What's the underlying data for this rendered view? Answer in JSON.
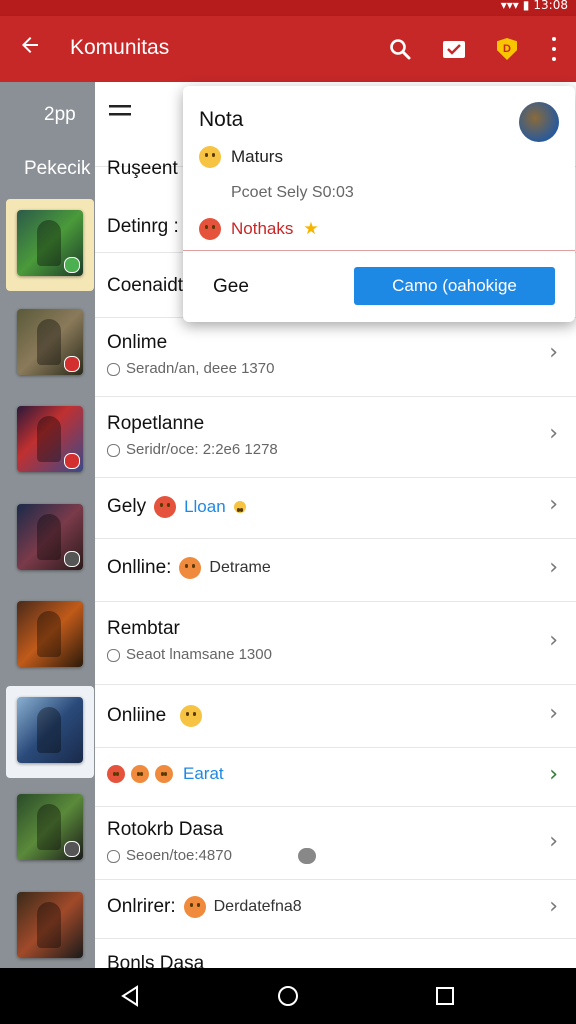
{
  "statusbar": {
    "time": "13:08"
  },
  "appbar": {
    "title": "Komunitas",
    "badge_letter": "D"
  },
  "rail": {
    "label_top": "2pp",
    "label_second": "Pekecik"
  },
  "popup": {
    "title": "Nota",
    "line1": "Maturs",
    "line2": "Pcoet Sely S0:03",
    "line3": "Nothaks",
    "close_label": "Gee",
    "cta_label": "Camo (oahokige"
  },
  "list": {
    "rows": [
      {
        "title": "Ruşeent"
      },
      {
        "title": "Detinrg :"
      },
      {
        "title": "Coenaidt"
      },
      {
        "title": "Onlime",
        "subtitle": "Seradn/an, deee 1370"
      },
      {
        "title": "Ropetlanne",
        "subtitle": "Seridr/oce: 2:2e6 1278"
      },
      {
        "title": "Gely",
        "tag": "Lloan"
      },
      {
        "title": "Onlline:",
        "tag": "Detrame"
      },
      {
        "title": "Rembtar",
        "subtitle": "Seaot lnamsane 1300"
      },
      {
        "title": "Onliine"
      },
      {
        "tag": "Earat"
      },
      {
        "title": "Rotokrb Dasa",
        "subtitle": "Seoen/toe:4870"
      },
      {
        "title": "Onlrirer:",
        "tag": "Derdatefna8"
      },
      {
        "title": "Bonls Dasa"
      }
    ]
  },
  "colors": {
    "appbar": "#c62828",
    "cta": "#1e88e5",
    "accent_green": "#2e7d32"
  },
  "icons": [
    "back-arrow-icon",
    "search-icon",
    "edit-icon",
    "shield-icon",
    "more-vert-icon",
    "chevron-right-icon",
    "nav-back-icon",
    "nav-home-icon",
    "nav-recents-icon"
  ]
}
